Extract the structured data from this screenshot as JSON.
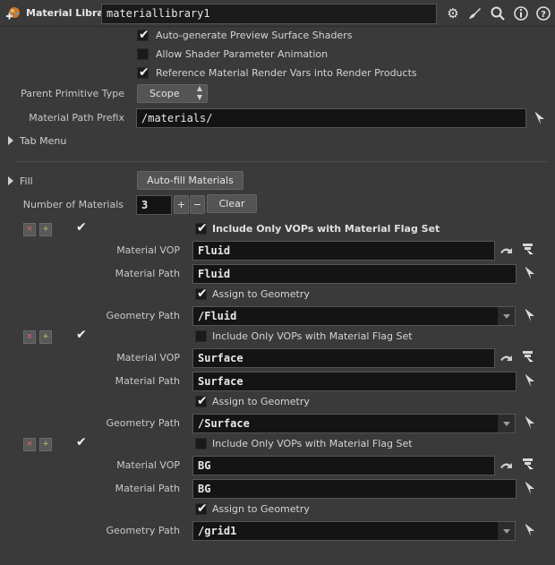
{
  "header": {
    "node_type": "Material Library",
    "node_name": "materiallibrary1"
  },
  "options": {
    "auto_generate": "Auto-generate Preview Surface Shaders",
    "allow_anim": "Allow Shader Parameter Animation",
    "reference_vars": "Reference Material Render Vars into Render Products"
  },
  "parent_prim": {
    "label": "Parent Primitive Type",
    "value": "Scope"
  },
  "mat_path_prefix": {
    "label": "Material Path Prefix",
    "value": "/materials/"
  },
  "tab_menu": {
    "label": "Tab Menu"
  },
  "fill": {
    "label": "Fill",
    "button": "Auto-fill Materials"
  },
  "num_materials": {
    "label": "Number of Materials",
    "value": "3",
    "plus": "+",
    "minus": "−",
    "clear": "Clear"
  },
  "materials": [
    {
      "flag_label": "Include Only VOPs with Material Flag Set",
      "vop_label": "Material VOP",
      "vop": "Fluid",
      "path_label": "Material Path",
      "path": "Fluid",
      "assign_label": "Assign to Geometry",
      "geo_label": "Geometry Path",
      "geo": "/Fluid"
    },
    {
      "flag_label": "Include Only VOPs with Material Flag Set",
      "vop_label": "Material VOP",
      "vop": "Surface",
      "path_label": "Material Path",
      "path": "Surface",
      "assign_label": "Assign to Geometry",
      "geo_label": "Geometry Path",
      "geo": "/Surface"
    },
    {
      "flag_label": "Include Only VOPs with Material Flag Set",
      "vop_label": "Material VOP",
      "vop": "BG",
      "path_label": "Material Path",
      "path": "BG",
      "assign_label": "Assign to Geometry",
      "geo_label": "Geometry Path",
      "geo": "/grid1"
    }
  ],
  "icons": {
    "gear": "⚙",
    "brush": "🖌",
    "search": "⌕",
    "info": "ⓘ",
    "help": "?",
    "check": "✔",
    "remove": "×",
    "insert": "+"
  }
}
